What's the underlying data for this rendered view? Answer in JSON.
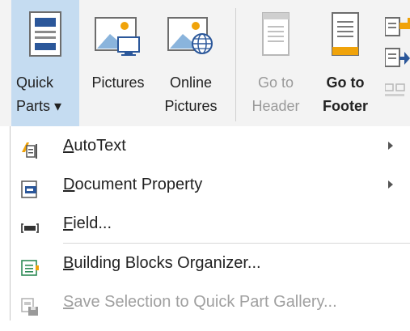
{
  "ribbon": {
    "buttons": [
      {
        "id": "quick-parts",
        "line1": "Quick",
        "line2": "Parts ▾",
        "icon": "quick-parts-icon",
        "selected": true
      },
      {
        "id": "pictures",
        "line1": "Pictures",
        "line2": "",
        "icon": "pictures-icon"
      },
      {
        "id": "online-pictures",
        "line1": "Online",
        "line2": "Pictures",
        "icon": "online-pictures-icon"
      },
      {
        "id": "go-to-header",
        "line1": "Go to",
        "line2": "Header",
        "icon": "go-to-header-icon",
        "disabled": true
      },
      {
        "id": "go-to-footer",
        "line1": "Go to",
        "line2": "Footer",
        "icon": "go-to-footer-icon"
      }
    ]
  },
  "menu": {
    "items": [
      {
        "key": "A",
        "rest": "utoText",
        "icon": "autotext-icon",
        "submenu": true
      },
      {
        "key": "D",
        "rest": "ocument Property",
        "icon": "document-property-icon",
        "submenu": true
      },
      {
        "key": "F",
        "rest": "ield...",
        "icon": "field-icon",
        "submenu": false
      },
      {
        "key": "B",
        "rest": "uilding Blocks Organizer...",
        "icon": "building-blocks-icon",
        "submenu": false
      },
      {
        "key": "S",
        "rest": "ave Selection to Quick Part Gallery...",
        "icon": "save-selection-icon",
        "submenu": false,
        "disabled": true
      }
    ]
  },
  "colors": {
    "accent": "#2b579a",
    "selected_bg": "#c5dcf1",
    "orange": "#f0a30a",
    "disabled": "#a0a0a0"
  }
}
